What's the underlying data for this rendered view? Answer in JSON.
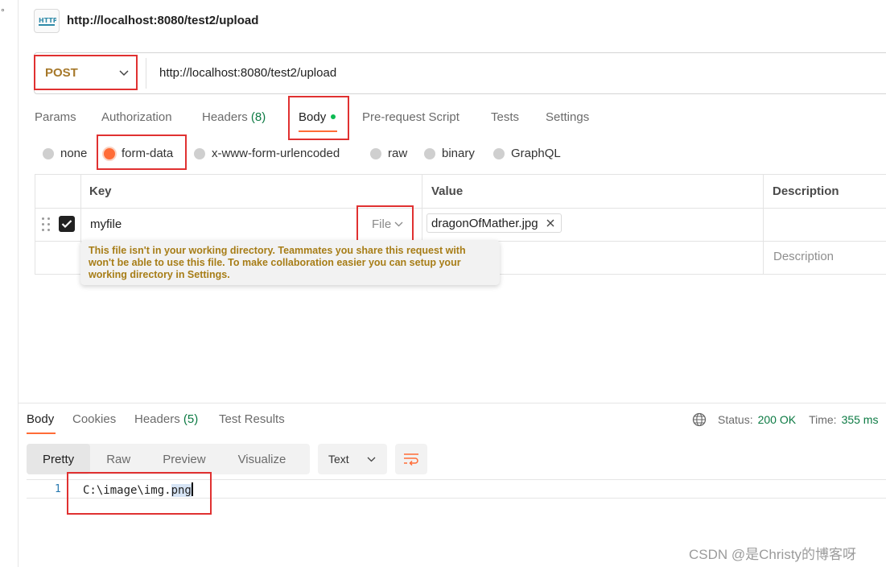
{
  "request": {
    "title": "http://localhost:8080/test2/upload",
    "method": "POST",
    "url": "http://localhost:8080/test2/upload"
  },
  "request_tabs": [
    {
      "label": "Params"
    },
    {
      "label": "Authorization"
    },
    {
      "label": "Headers",
      "count": "(8)"
    },
    {
      "label": "Body"
    },
    {
      "label": "Pre-request Script"
    },
    {
      "label": "Tests"
    },
    {
      "label": "Settings"
    }
  ],
  "body_types": [
    {
      "label": "none"
    },
    {
      "label": "form-data"
    },
    {
      "label": "x-www-form-urlencoded"
    },
    {
      "label": "raw"
    },
    {
      "label": "binary"
    },
    {
      "label": "GraphQL"
    }
  ],
  "table": {
    "headers": {
      "key": "Key",
      "value": "Value",
      "description": "Description"
    },
    "row": {
      "key": "myfile",
      "type": "File",
      "file_name": "dragonOfMather.jpg"
    },
    "description_placeholder": "Description",
    "tooltip": "This file isn't in your working directory. Teammates you share this request with won't be able to use this file. To make collaboration easier you can setup your working directory in Settings."
  },
  "response": {
    "tabs": [
      {
        "label": "Body"
      },
      {
        "label": "Cookies"
      },
      {
        "label": "Headers",
        "count": "(5)"
      },
      {
        "label": "Test Results"
      }
    ],
    "status_label": "Status:",
    "status_value": "200 OK",
    "time_label": "Time:",
    "time_value": "355 ms",
    "views": [
      "Pretty",
      "Raw",
      "Preview",
      "Visualize"
    ],
    "format": "Text",
    "line_number": "1",
    "code_plain": "C:\\image\\img.",
    "code_selected": "png"
  },
  "watermark": "CSDN @是Christy的博客呀",
  "colors": {
    "accent": "#ff6c37",
    "method": "#a6782a",
    "success": "#0c7a43",
    "highlight_box": "#e03131"
  }
}
